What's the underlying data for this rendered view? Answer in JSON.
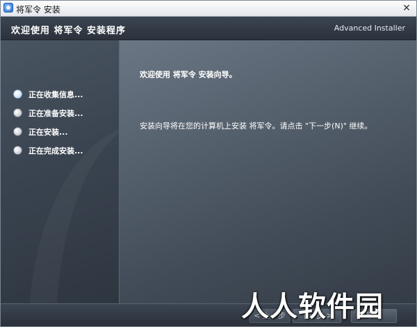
{
  "window": {
    "title": "将军令 安装",
    "close_glyph": "✕"
  },
  "header": {
    "title": "欢迎使用 将军令 安装程序",
    "brand": "Advanced Installer"
  },
  "sidebar": {
    "steps": [
      {
        "label": "正在收集信息...",
        "state": "current"
      },
      {
        "label": "正在准备安装...",
        "state": "pending"
      },
      {
        "label": "正在安装...",
        "state": "pending"
      },
      {
        "label": "正在完成安装...",
        "state": "pending"
      }
    ]
  },
  "main": {
    "heading": "欢迎使用 将军令 安装向导。",
    "body": "安装向导将在您的计算机上安装 将军令。请点击 \"下一步(N)\" 继续。"
  },
  "footer": {
    "back_label": "< 上一步",
    "next_label": "下一步 >",
    "cancel_label": "取消"
  },
  "watermark": {
    "text": "人人软件园"
  },
  "colors": {
    "header_bg": "#2f3742",
    "sidebar_bg": "#3a4450",
    "main_bg": "#55606d",
    "text": "#ffffff"
  },
  "icons": {
    "app": "installer-app-icon",
    "close": "close-icon",
    "step": "radio-step-icon"
  }
}
